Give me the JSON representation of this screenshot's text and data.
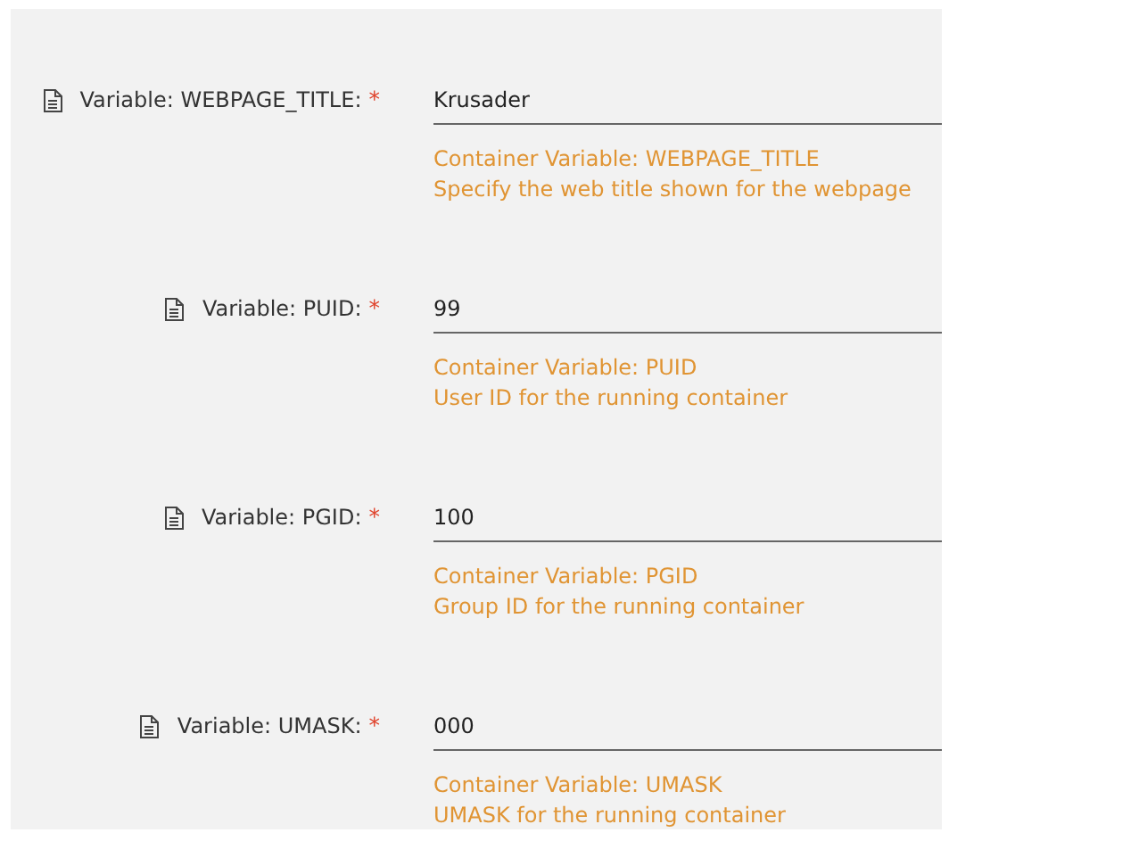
{
  "variables": [
    {
      "label": "Variable: WEBPAGE_TITLE:",
      "required_mark": "*",
      "value": "Krusader",
      "description": [
        "Container Variable: WEBPAGE_TITLE",
        "Specify the web title shown for the webpage"
      ]
    },
    {
      "label": "Variable: PUID:",
      "required_mark": "*",
      "value": "99",
      "description": [
        "Container Variable: PUID",
        "User ID for the running container"
      ]
    },
    {
      "label": "Variable: PGID:",
      "required_mark": "*",
      "value": "100",
      "description": [
        "Container Variable: PGID",
        "Group ID for the running container"
      ]
    },
    {
      "label": "Variable: UMASK:",
      "required_mark": "*",
      "value": "000",
      "description": [
        "Container Variable: UMASK",
        "UMASK for the running container"
      ]
    }
  ]
}
